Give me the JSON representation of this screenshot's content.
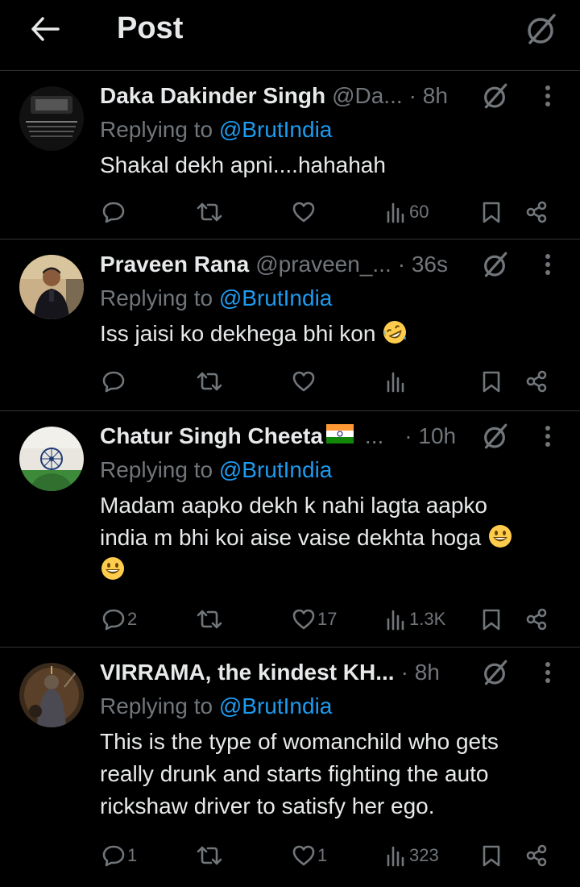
{
  "header": {
    "title": "Post"
  },
  "replies": [
    {
      "name": "Daka Dakinder Singh",
      "handle": "@Da...",
      "time": "· 8h",
      "replying_prefix": "Replying to ",
      "mention": "@BrutIndia",
      "text": "Shakal dekh apni....hahahah",
      "counts": {
        "replies": "",
        "reposts": "",
        "likes": "",
        "views": "60"
      }
    },
    {
      "name": "Praveen Rana",
      "handle": "@praveen_...",
      "time": "· 36s",
      "replying_prefix": "Replying to ",
      "mention": "@BrutIndia",
      "text": "Iss jaisi ko dekhega bhi kon",
      "counts": {
        "replies": "",
        "reposts": "",
        "likes": "",
        "views": ""
      }
    },
    {
      "name": "Chatur Singh Cheeta",
      "handle": "...",
      "time": "· 10h",
      "replying_prefix": "Replying to ",
      "mention": "@BrutIndia",
      "text_line1": "Madam aapko dekh k nahi lagta aapko",
      "text_line2": "india m bhi koi aise vaise dekhta hoga",
      "counts": {
        "replies": "2",
        "reposts": "",
        "likes": "17",
        "views": "1.3K"
      }
    },
    {
      "name": "VIRRAMA, the kindest KH...",
      "handle": "",
      "time": "· 8h",
      "replying_prefix": "Replying to ",
      "mention": "@BrutIndia",
      "text_line1": "This is the type of womanchild who gets",
      "text_line2": "really drunk and starts fighting the auto",
      "text_line3": "rickshaw driver to satisfy her ego.",
      "counts": {
        "replies": "1",
        "reposts": "",
        "likes": "1",
        "views": "323"
      }
    }
  ],
  "colors": {
    "background": "#000000",
    "text": "#e7e9ea",
    "muted": "#71767b",
    "link": "#1d9bf0",
    "divider": "#2f3336"
  },
  "icons": [
    "back-arrow-icon",
    "grok-icon",
    "more-vertical-icon",
    "reply-icon",
    "repost-icon",
    "like-icon",
    "views-icon",
    "bookmark-icon",
    "share-icon"
  ]
}
